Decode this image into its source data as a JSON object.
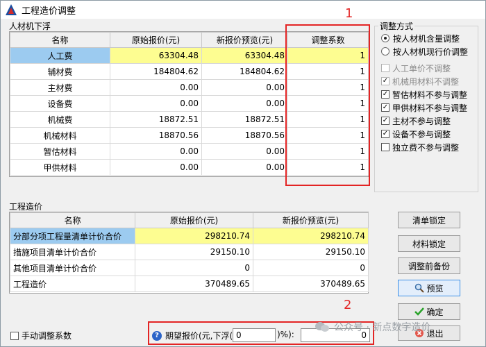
{
  "window": {
    "title": "工程造价调整"
  },
  "labor_group": {
    "label": "人材机下浮",
    "columns": [
      "名称",
      "原始报价(元)",
      "新报价预览(元)",
      "调整系数"
    ],
    "rows": [
      [
        "人工费",
        "63304.48",
        "63304.48",
        "1"
      ],
      [
        "辅材费",
        "184804.62",
        "184804.62",
        "1"
      ],
      [
        "主材费",
        "0.00",
        "0.00",
        "1"
      ],
      [
        "设备费",
        "0.00",
        "0.00",
        "1"
      ],
      [
        "机械费",
        "18872.51",
        "18872.51",
        "1"
      ],
      [
        "机械材料",
        "18870.56",
        "18870.56",
        "1"
      ],
      [
        "暂估材料",
        "0.00",
        "0.00",
        "1"
      ],
      [
        "甲供材料",
        "0.00",
        "0.00",
        "1"
      ]
    ]
  },
  "cost_group": {
    "label": "工程造价",
    "columns": [
      "名称",
      "原始报价(元)",
      "新报价预览(元)"
    ],
    "rows": [
      [
        "分部分项工程量清单计价合价",
        "298210.74",
        "298210.74"
      ],
      [
        "措施项目清单计价合价",
        "29150.10",
        "29150.10"
      ],
      [
        "其他项目清单计价合价",
        "0",
        "0"
      ],
      [
        "工程造价",
        "370489.65",
        "370489.65"
      ]
    ]
  },
  "adjust_mode": {
    "label": "调整方式",
    "radios": [
      "按人材机含量调整",
      "按人材机现行价调整"
    ],
    "checks": [
      {
        "label": "人工单价不调整",
        "checked": false,
        "disabled": true
      },
      {
        "label": "机械用材料不调整",
        "checked": true,
        "disabled": true
      },
      {
        "label": "暂估材料不参与调整",
        "checked": true,
        "disabled": false
      },
      {
        "label": "甲供材料不参与调整",
        "checked": true,
        "disabled": false
      },
      {
        "label": "主材不参与调整",
        "checked": true,
        "disabled": false
      },
      {
        "label": "设备不参与调整",
        "checked": true,
        "disabled": false
      },
      {
        "label": "独立费不参与调整",
        "checked": false,
        "disabled": false
      }
    ]
  },
  "buttons": {
    "lock_list": "清单锁定",
    "lock_material": "材料锁定",
    "restore_backup": "调整前备份",
    "preview": "预览",
    "confirm": "确定",
    "exit": "退出"
  },
  "bottom": {
    "manual_label": "手动调整系数",
    "expected_label": "期望报价(元,下浮(",
    "percent_label": ")%):",
    "percent_value": "0",
    "price_value": "0"
  },
  "annotations": {
    "one": "1",
    "two": "2"
  },
  "watermark": "公众号 · 新点数字造价",
  "colors": {
    "selected_name": "#9ccbf0",
    "selected_value": "#fdfd91",
    "annotation": "#e32424"
  }
}
